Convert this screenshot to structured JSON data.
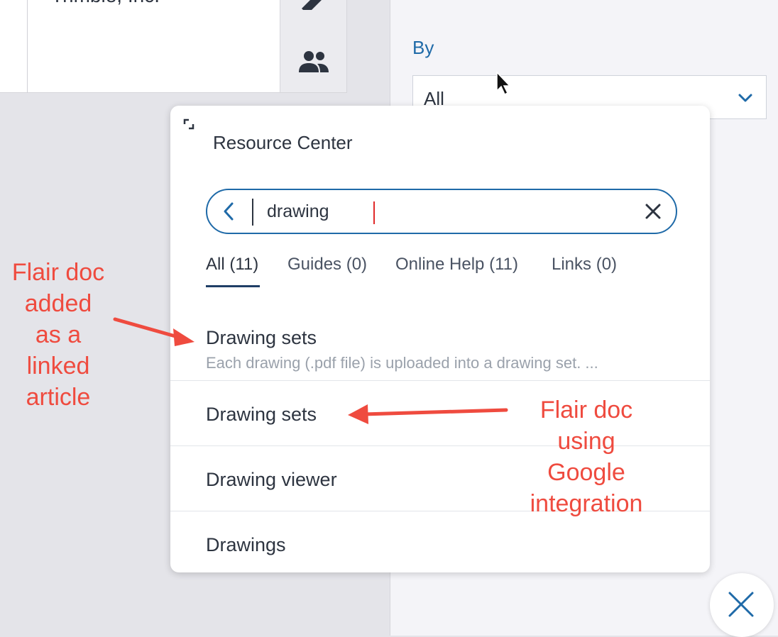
{
  "background": {
    "company_name": "Trimble, Inc.",
    "by_label": "By",
    "by_select_value": "All"
  },
  "resource_center": {
    "title": "Resource Center",
    "search_query": "drawing",
    "tabs": [
      {
        "label": "All (11)",
        "active": true
      },
      {
        "label": "Guides (0)",
        "active": false
      },
      {
        "label": "Online Help (11)",
        "active": false
      },
      {
        "label": "Links (0)",
        "active": false
      }
    ],
    "results": [
      {
        "title": "Drawing sets",
        "description": "Each drawing (.pdf file) is uploaded into a drawing set. ..."
      },
      {
        "title": "Drawing sets",
        "description": ""
      },
      {
        "title": "Drawing viewer",
        "description": ""
      },
      {
        "title": "Drawings",
        "description": ""
      }
    ]
  },
  "annotations": {
    "left": [
      "Flair doc",
      "added",
      "as a",
      "linked",
      "article"
    ],
    "right": [
      "Flair doc",
      "using",
      "Google",
      "integration"
    ]
  },
  "colors": {
    "accent": "#1f6aa8",
    "annotation": "#ef4b3f"
  },
  "icons": {
    "expand": "expand-icon",
    "back": "chevron-left-icon",
    "clear": "close-icon",
    "select": "chevron-down-icon",
    "people": "people-icon",
    "edit": "pencil-icon",
    "fab": "close-icon"
  }
}
